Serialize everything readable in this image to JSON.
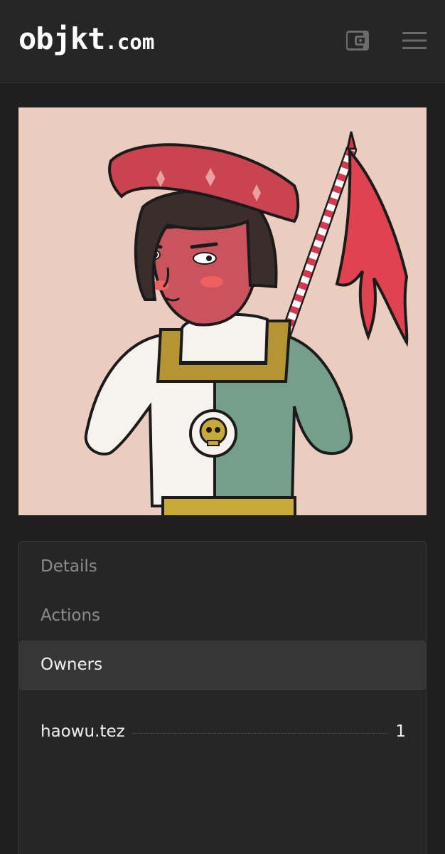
{
  "header": {
    "logo_brand": "objkt",
    "logo_tld": ".com",
    "wallet_icon": "wallet-icon",
    "menu_icon": "hamburger-menu-icon"
  },
  "artwork": {
    "alt": "Illustration of a figure with red crown holding a red striped flag, skull badge on split white and green shirt"
  },
  "tabs": [
    {
      "label": "Details",
      "active": false
    },
    {
      "label": "Actions",
      "active": false
    },
    {
      "label": "Owners",
      "active": true
    }
  ],
  "owners": [
    {
      "name": "haowu.tez",
      "quantity": "1"
    }
  ],
  "colors": {
    "background": "#1f1f1f",
    "header": "#262626",
    "panel": "#262626",
    "active_tab": "#363636",
    "artwork_bg": "#eacdbf"
  }
}
